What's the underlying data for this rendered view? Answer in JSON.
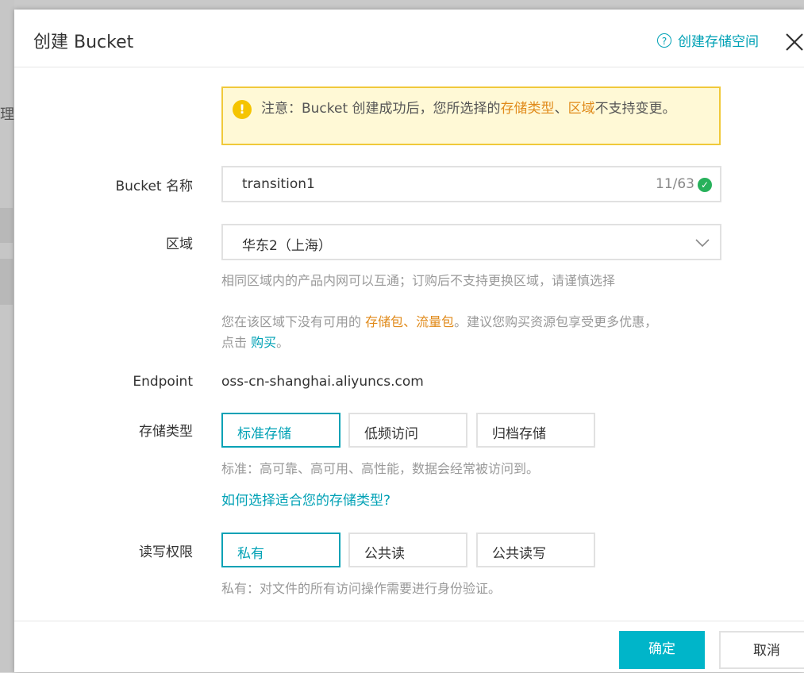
{
  "background": {
    "side_char": "理"
  },
  "dialog": {
    "title": "创建 Bucket",
    "help_link": "创建存储空间"
  },
  "notice": {
    "prefix": "注意：Bucket 创建成功后，您所选择的",
    "storage_type": "存储类型",
    "sep": "、",
    "region": "区域",
    "suffix": "不支持变更。"
  },
  "form": {
    "bucket_name": {
      "label": "Bucket 名称",
      "value": "transition1",
      "counter": "11/63"
    },
    "region": {
      "label": "区域",
      "value": "华东2（上海）",
      "hint": "相同区域内的产品内网可以互通；订购后不支持更换区域，请谨慎选择",
      "pkg_prefix": "您在该区域下没有可用的 ",
      "storage_pkg": "存储包",
      "pkg_sep": "、",
      "traffic_pkg": "流量包",
      "pkg_mid": "。建议您购买资源包享受更多优惠，",
      "pkg_line2": "点击 ",
      "buy_link": "购买",
      "pkg_end": "。"
    },
    "endpoint": {
      "label": "Endpoint",
      "value": "oss-cn-shanghai.aliyuncs.com"
    },
    "storage_class": {
      "label": "存储类型",
      "options": [
        "标准存储",
        "低频访问",
        "归档存储"
      ],
      "selected": "标准存储",
      "hint": "标准：高可靠、高可用、高性能，数据会经常被访问到。",
      "help_link": "如何选择适合您的存储类型?"
    },
    "acl": {
      "label": "读写权限",
      "options": [
        "私有",
        "公共读",
        "公共读写"
      ],
      "selected": "私有",
      "hint": "私有：对文件的所有访问操作需要进行身份验证。"
    }
  },
  "footer": {
    "ok_label": "确定",
    "cancel_label": "取消"
  },
  "colors": {
    "accent": "#00a1b5",
    "primary_button": "#00b5c9",
    "warning": "#f5c400",
    "highlight": "#e08a1a",
    "success": "#27b15b"
  },
  "icons": {
    "help": "help-circle-icon",
    "close": "close-icon",
    "warning": "warning-icon",
    "check": "check-circle-icon",
    "dropdown": "chevron-down-icon"
  }
}
